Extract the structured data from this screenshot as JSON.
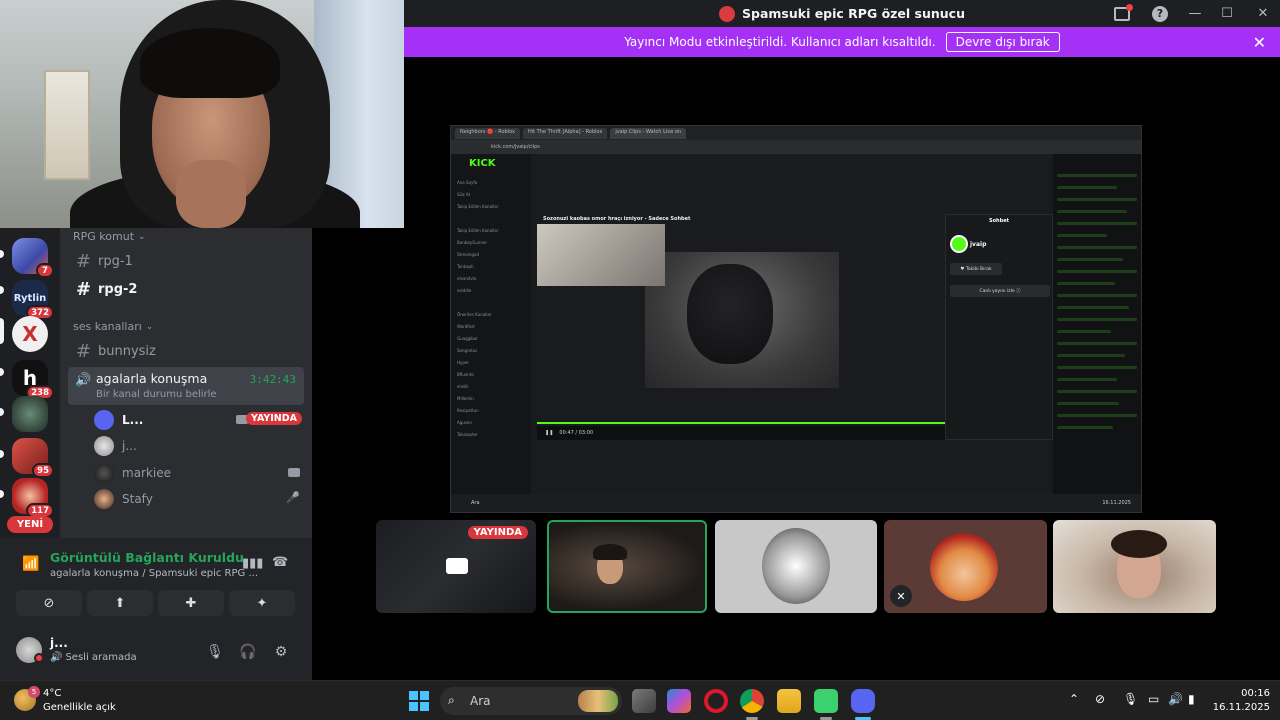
{
  "window": {
    "server_title": "Spamsuki epic RPG özel sunucu",
    "banner_text": "Yayıncı Modu etkinleştirildi. Kullanıcı adları kısaltıldı.",
    "banner_button": "Devre dışı bırak",
    "close_glyph": "✕",
    "minimize_glyph": "—",
    "maximize_glyph": "☐",
    "help_glyph": "?"
  },
  "servers": [
    {
      "name": "server-1",
      "badge": "7",
      "color": "#4a5fc1"
    },
    {
      "name": "server-2",
      "badge": "372",
      "color": "#2d3b66",
      "label": "Rytlin"
    },
    {
      "name": "server-3",
      "badge": "",
      "color": "#c4312f",
      "label": "X"
    },
    {
      "name": "server-4",
      "badge": "238",
      "color": "#222",
      "label": "h"
    },
    {
      "name": "server-5",
      "badge": "",
      "color": "#3d5a4a"
    },
    {
      "name": "server-6",
      "badge": "95",
      "color": "#b8332e"
    },
    {
      "name": "server-7",
      "badge": "117",
      "color": "#c22d2d"
    }
  ],
  "new_badge": "YENİ",
  "channels": {
    "category_text": "RPG komut",
    "text_channels": [
      "rpg-1",
      "rpg-2"
    ],
    "category_voice": "ses kanalları",
    "voice_channel_1": "bunnysiz",
    "active_voice": {
      "name": "agalarla konuşma",
      "status_placeholder": "Bir kanal durumu belirle",
      "timer": "3:42:43"
    },
    "voice_users": [
      {
        "name": "L...",
        "live": "YAYINDA"
      },
      {
        "name": "j...",
        "live": ""
      },
      {
        "name": "markiee",
        "live": ""
      },
      {
        "name": "Stafy",
        "live": ""
      }
    ]
  },
  "voice_panel": {
    "status": "Görüntülü Bağlantı Kuruldu",
    "location": "agalarla konuşma / Spamsuki epic RPG ..."
  },
  "user_panel": {
    "name": "j...",
    "status": "Sesli aramada"
  },
  "stream": {
    "tabs": [
      "Neighbors 🔴 - Roblox",
      "Hit The Thrift [Alpha] - Roblox",
      "jvaip Clips - Watch Live on"
    ],
    "url": "kick.com/jvaip/clips",
    "site_logo": "KICK",
    "pip_title": "Sozonuzi kaobas omor hraçı izniyor - Sadece Sohbet",
    "chat_header": "Sohbet",
    "chat_user": "jvaip",
    "follow_button": "♥ Takibi Bırak",
    "live_button": "Canlı yayını izle ⓘ",
    "player_time": "00:47 / 03:00",
    "inner_taskbar_search": "Ara",
    "inner_clock": "16.11.2025",
    "nav_items": [
      "Ana Sayfa",
      "Göz At",
      "Takip Edilen Kanallar",
      "Takip Edilen Kanallar",
      "BunbayGunner",
      "Streamgod",
      "Tonkaph",
      "elvandvlo",
      "esiddie",
      "Önerilen Kanallar",
      "Wardfest",
      "Guaggibor",
      "Songrotus",
      "Hyper",
      "Bfluento",
      "eratik",
      "Millomin",
      "Rexipattun",
      "Agusen",
      "Tokaiopter"
    ]
  },
  "tiles": [
    {
      "name": "screen-share-tile",
      "live": "YAYINDA"
    },
    {
      "name": "camera-tile-1"
    },
    {
      "name": "avatar-tile-2"
    },
    {
      "name": "avatar-tile-3"
    },
    {
      "name": "camera-tile-4"
    }
  ],
  "taskbar": {
    "weather_badge": "5",
    "temperature": "4°C",
    "condition": "Genellikle açık",
    "search_placeholder": "Ara",
    "time": "00:16",
    "date": "16.11.2025"
  }
}
